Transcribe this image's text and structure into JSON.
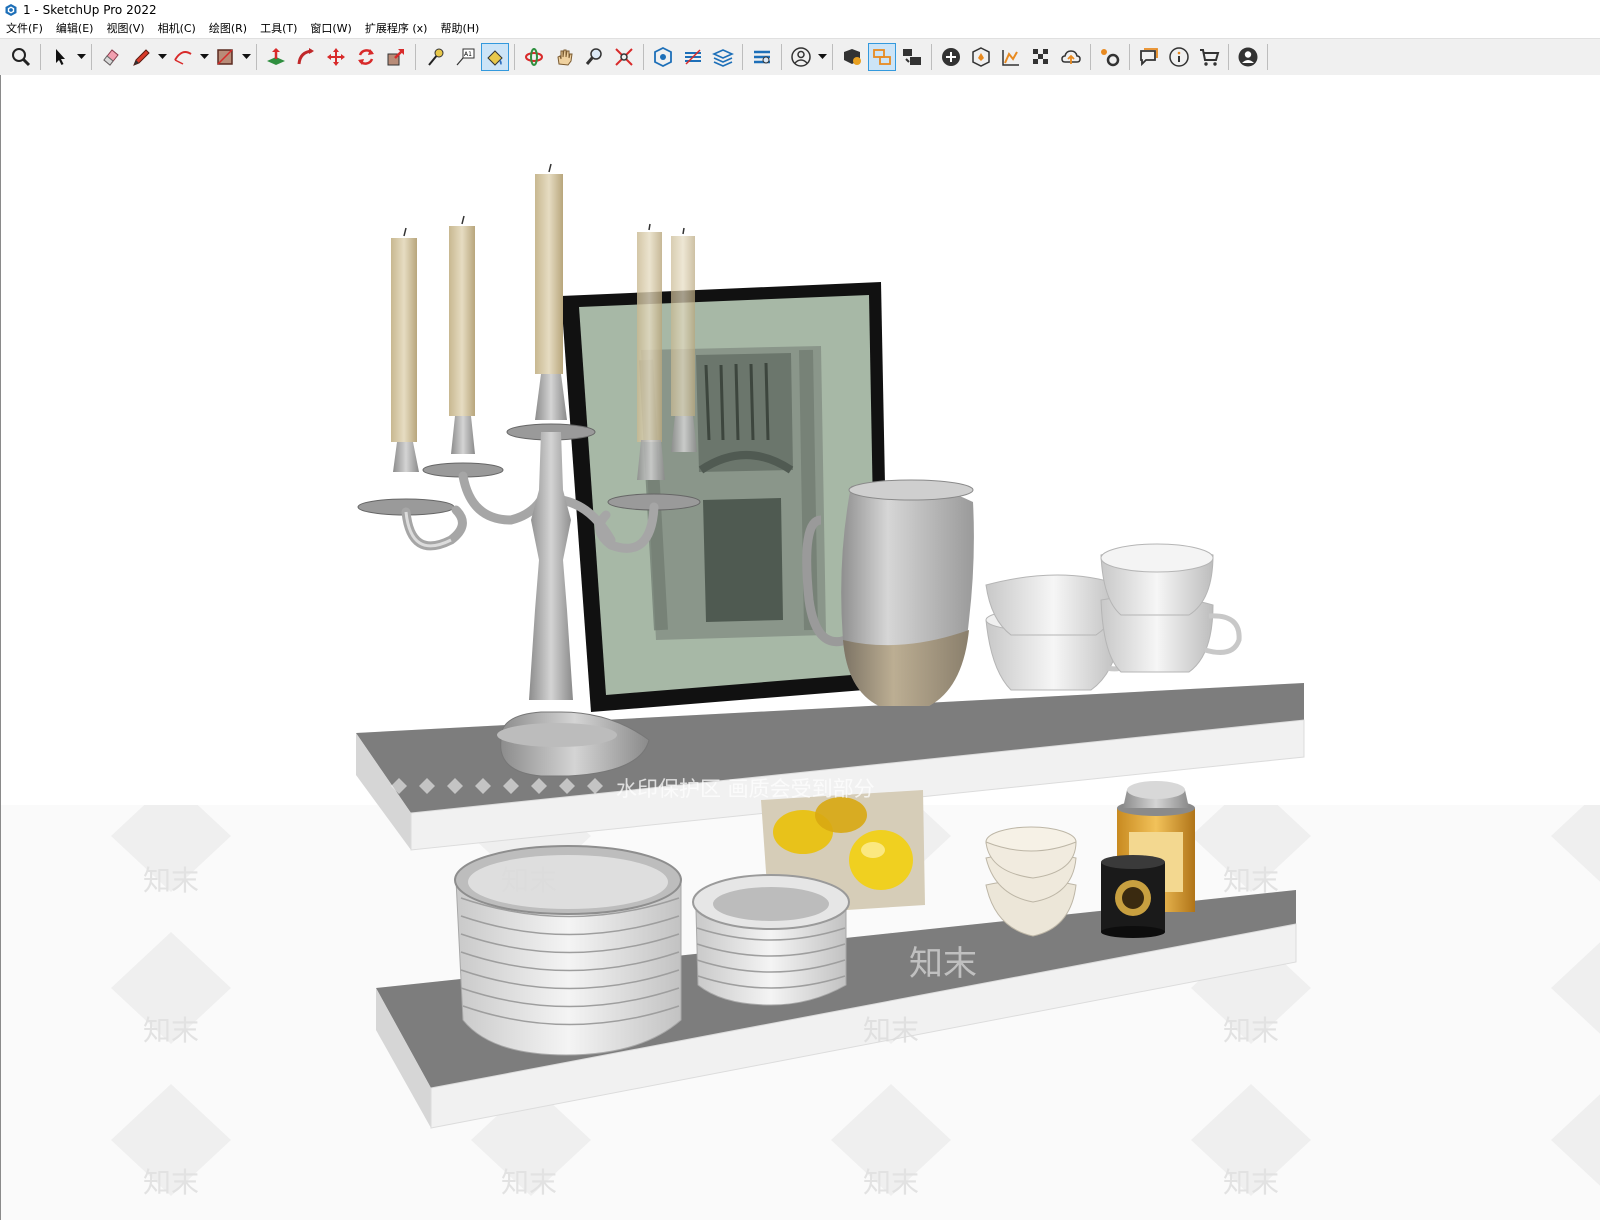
{
  "window": {
    "title": "1 - SketchUp Pro 2022"
  },
  "menu": [
    {
      "id": "file",
      "label": "文件(F)"
    },
    {
      "id": "edit",
      "label": "编辑(E)"
    },
    {
      "id": "view",
      "label": "视图(V)"
    },
    {
      "id": "camera",
      "label": "相机(C)"
    },
    {
      "id": "draw",
      "label": "绘图(R)"
    },
    {
      "id": "tools",
      "label": "工具(T)"
    },
    {
      "id": "window",
      "label": "窗口(W)"
    },
    {
      "id": "extensions",
      "label": "扩展程序 (x)"
    },
    {
      "id": "help",
      "label": "帮助(H)"
    }
  ],
  "toolbar_icons": [
    "zoom-window-icon",
    "select-arrow-icon",
    "eraser-icon",
    "pencil-line-icon",
    "arc-icon",
    "rectangle-icon",
    "push-pull-icon",
    "follow-me-icon",
    "move-icon",
    "rotate-icon",
    "scale-icon",
    "tape-measure-icon",
    "text-label-icon",
    "paint-bucket-icon",
    "orbit-icon",
    "pan-hand-icon",
    "zoom-icon",
    "zoom-extents-icon",
    "section-plane-icon",
    "section-fill-icon",
    "section-cuts-icon",
    "tags-icon",
    "user-profile-icon",
    "components-icon",
    "outliner-icon",
    "scenes-icon",
    "add-location-icon",
    "terrain-icon",
    "sandbox-icon",
    "texture-icon",
    "cloud-upload-icon",
    "extension-manager-icon",
    "comments-icon",
    "info-icon",
    "shopping-cart-icon",
    "account-icon"
  ],
  "watermark": {
    "text": "水印保护区  画质会受到部分",
    "tile_text": "知末"
  },
  "colors": {
    "toolbar_bg": "#f0f0f0",
    "shelf_top": "#7d7d7d",
    "shelf_edge": "#e8e8e8",
    "frame": "#111111",
    "mat": "#a7b8a6",
    "candle": "#d8cba6",
    "selection_blue": "#3399dd"
  }
}
